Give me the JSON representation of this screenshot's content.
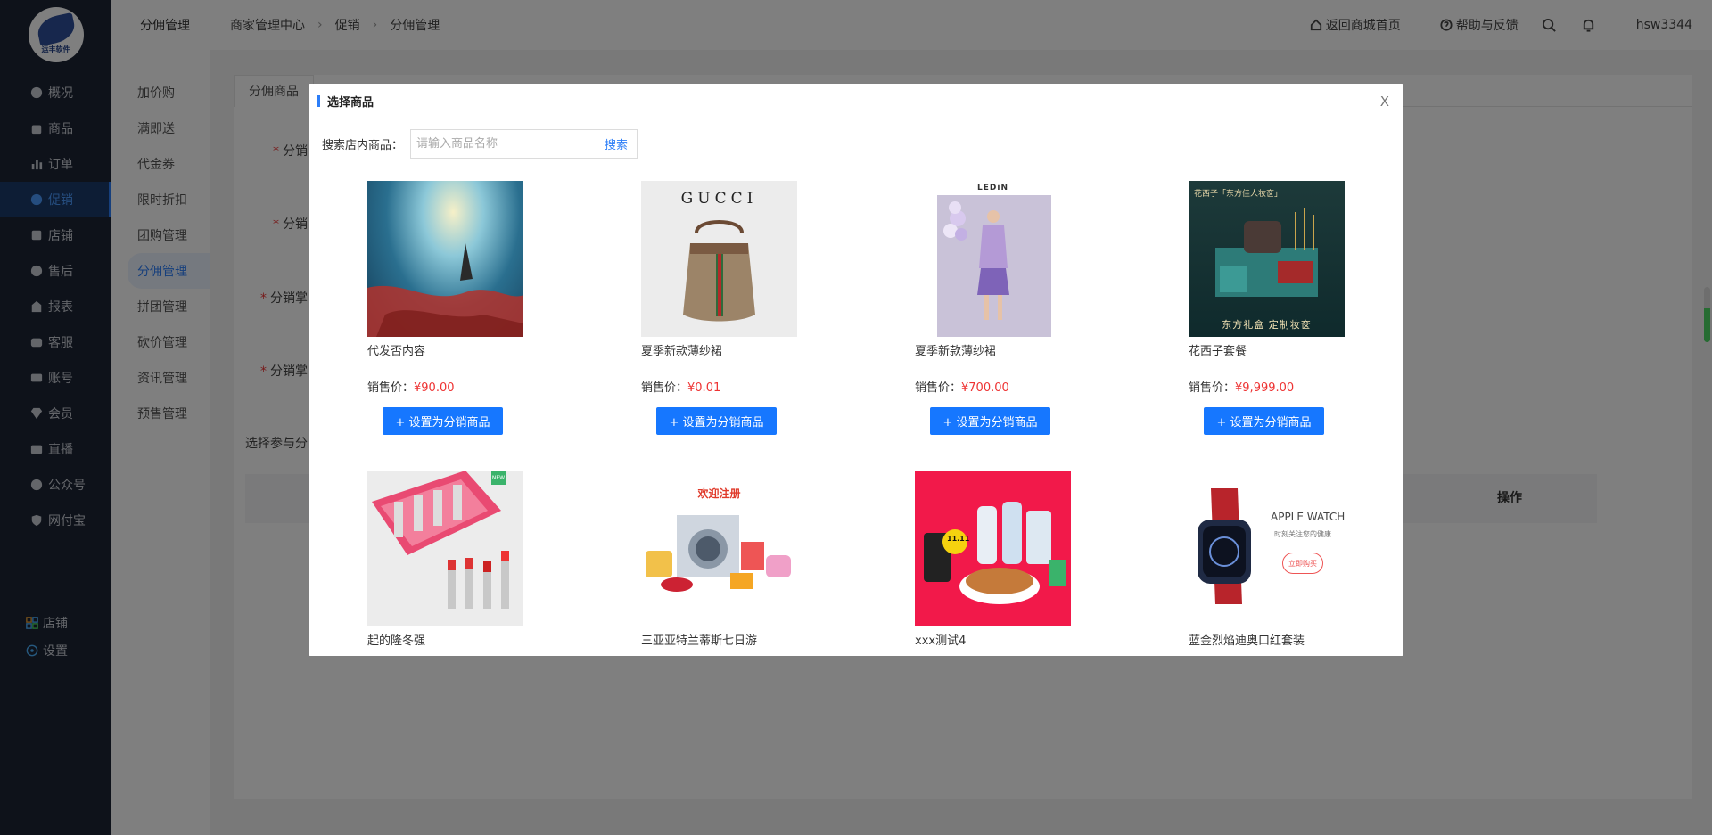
{
  "brand": {
    "logo_text": "运丰软件"
  },
  "sidebar": {
    "items": [
      {
        "label": "概况",
        "icon": "dashboard-icon"
      },
      {
        "label": "商品",
        "icon": "bag-icon"
      },
      {
        "label": "订单",
        "icon": "chart-icon"
      },
      {
        "label": "促销",
        "icon": "promo-icon",
        "active": true
      },
      {
        "label": "店铺",
        "icon": "store-icon"
      },
      {
        "label": "售后",
        "icon": "aftersale-icon"
      },
      {
        "label": "报表",
        "icon": "report-icon"
      },
      {
        "label": "客服",
        "icon": "service-icon"
      },
      {
        "label": "账号",
        "icon": "account-icon"
      },
      {
        "label": "会员",
        "icon": "diamond-icon"
      },
      {
        "label": "直播",
        "icon": "live-icon"
      },
      {
        "label": "公众号",
        "icon": "wechat-icon"
      },
      {
        "label": "网付宝",
        "icon": "shield-icon"
      }
    ],
    "bottom": [
      {
        "label": "店铺",
        "icon": "grid-icon"
      },
      {
        "label": "设置",
        "icon": "settings-icon"
      }
    ]
  },
  "subnav": {
    "title": "分佣管理",
    "items": [
      "加价购",
      "满即送",
      "代金券",
      "限时折扣",
      "团购管理",
      "分佣管理",
      "拼团管理",
      "砍价管理",
      "资讯管理",
      "预售管理"
    ]
  },
  "topbar": {
    "breadcrumb": [
      "商家管理中心",
      "促销",
      "分佣管理"
    ],
    "back_home": "返回商城首页",
    "help": "帮助与反馈",
    "username": "hsw3344"
  },
  "page": {
    "tabs": [
      "分佣商品"
    ],
    "form_labels": [
      "分销",
      "分销",
      "分销掌",
      "分销掌"
    ],
    "list_label": "选择参与分",
    "table_op": "操作"
  },
  "modal": {
    "title": "选择商品",
    "close": "X",
    "search_label": "搜索店内商品：",
    "search_placeholder": "请输入商品名称",
    "search_button": "搜索",
    "price_label": "销售价：",
    "add_button": "+ 设置为分销商品",
    "products": [
      {
        "name": "代发否内容",
        "price": "¥90.00"
      },
      {
        "name": "夏季新款薄纱裙",
        "price": "¥0.01"
      },
      {
        "name": "夏季新款薄纱裙",
        "price": "¥700.00"
      },
      {
        "name": "花西子套餐",
        "price": "¥9,999.00"
      },
      {
        "name": "起的隆冬强"
      },
      {
        "name": "三亚亚特兰蒂斯七日游"
      },
      {
        "name": "xxx测试4"
      },
      {
        "name": "蓝金烈焰迪奥口红套装"
      }
    ],
    "image_text": {
      "gucci": "GUCCI",
      "ledin": "LEDiN",
      "huaxizi_top": "花西子「东方佳人妆奁」",
      "huaxizi_bottom": "东方礼盒 定制妆奁",
      "welcome": "欢迎注册",
      "promo_1111": "11.11",
      "apple_watch": "APPLE WATCH",
      "apple_watch_sub": "时刻关注您的健康",
      "buy_now": "立即购买",
      "new_tag": "NEW"
    }
  }
}
